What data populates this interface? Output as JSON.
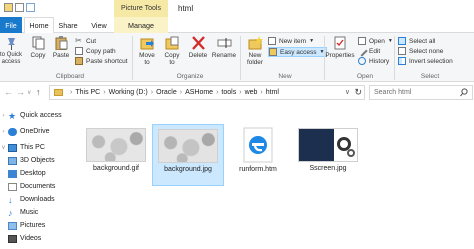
{
  "titlebar": {
    "context_tab": "Picture Tools",
    "window_title": "html"
  },
  "tabs": {
    "file": "File",
    "home": "Home",
    "share": "Share",
    "view": "View",
    "manage": "Manage"
  },
  "ribbon": {
    "clipboard": {
      "pin_label": "to Quick access",
      "copy": "Copy",
      "paste": "Paste",
      "cut": "Cut",
      "copy_path": "Copy path",
      "paste_shortcut": "Paste shortcut",
      "group_label": "Clipboard"
    },
    "organize": {
      "move_to": "Move to",
      "copy_to": "Copy to",
      "delete": "Delete",
      "rename": "Rename",
      "group_label": "Organize"
    },
    "new": {
      "new_item": "New item",
      "easy_access": "Easy access",
      "new_folder": "New folder",
      "group_label": "New"
    },
    "open": {
      "properties": "Properties",
      "open": "Open",
      "edit": "Edit",
      "history": "History",
      "group_label": "Open"
    },
    "select": {
      "select_all": "Select all",
      "select_none": "Select none",
      "invert_selection": "Invert selection",
      "group_label": "Select"
    }
  },
  "address": {
    "crumbs": [
      "This PC",
      "Working (D:)",
      "Oracle",
      "ASHome",
      "tools",
      "web",
      "html"
    ],
    "search_placeholder": "Search html"
  },
  "nav": {
    "items": [
      {
        "label": "Quick access",
        "icon": "star-icon"
      },
      {
        "label": "OneDrive",
        "icon": "cloud-icon"
      },
      {
        "label": "This PC",
        "icon": "computer-icon"
      },
      {
        "label": "3D Objects",
        "icon": "cube-icon"
      },
      {
        "label": "Desktop",
        "icon": "desktop-icon"
      },
      {
        "label": "Documents",
        "icon": "documents-icon"
      },
      {
        "label": "Downloads",
        "icon": "download-icon"
      },
      {
        "label": "Music",
        "icon": "music-icon"
      },
      {
        "label": "Pictures",
        "icon": "pictures-icon"
      },
      {
        "label": "Videos",
        "icon": "video-icon"
      }
    ]
  },
  "files": [
    {
      "name": "background.gif",
      "selected": false
    },
    {
      "name": "background.jpg",
      "selected": true
    },
    {
      "name": "runform.htm",
      "selected": false
    },
    {
      "name": "Sscreen.jpg",
      "selected": false
    }
  ],
  "colors": {
    "accent": "#1979ca",
    "context_tab": "#f6e9a6",
    "selection": "#cce8ff"
  }
}
